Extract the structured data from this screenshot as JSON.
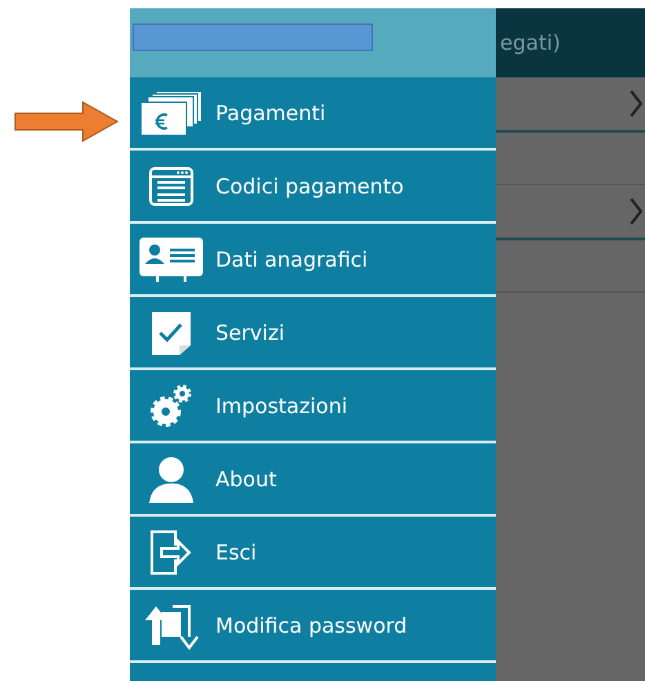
{
  "background_screen": {
    "header_text": "egati)"
  },
  "menu": {
    "items": [
      {
        "label": "Pagamenti"
      },
      {
        "label": "Codici pagamento"
      },
      {
        "label": "Dati anagrafici"
      },
      {
        "label": "Servizi"
      },
      {
        "label": "Impostazioni"
      },
      {
        "label": "About"
      },
      {
        "label": "Esci"
      },
      {
        "label": "Modifica password"
      }
    ]
  }
}
